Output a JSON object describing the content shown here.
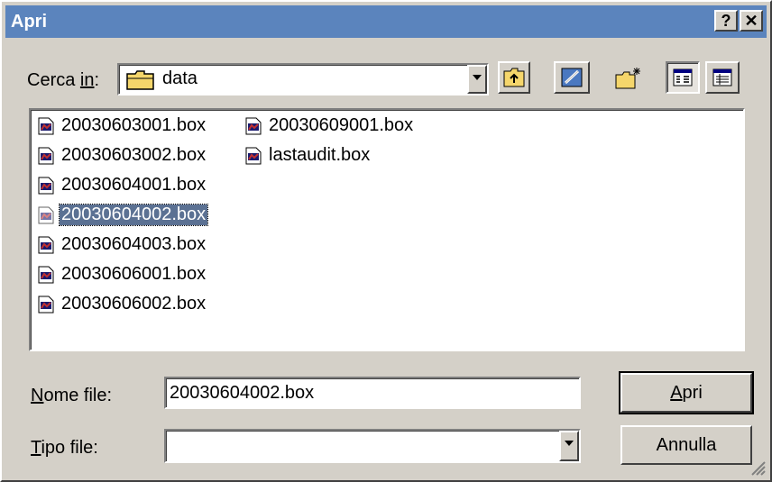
{
  "window": {
    "title": "Apri",
    "help_label": "?",
    "close_label": "✕"
  },
  "look_in": {
    "label_prefix": "Cerca ",
    "label_underline": "in",
    "label_suffix": ":",
    "value": "data",
    "folder_icon": "folder-icon"
  },
  "toolbar": {
    "up_icon": "up-folder-icon",
    "desktop_icon": "desktop-icon",
    "new_folder_icon": "new-folder-icon",
    "list_view_icon": "list-view-icon",
    "details_view_icon": "details-view-icon"
  },
  "files": [
    {
      "name": "20030603001.box",
      "selected": false
    },
    {
      "name": "20030603002.box",
      "selected": false
    },
    {
      "name": "20030604001.box",
      "selected": false
    },
    {
      "name": "20030604002.box",
      "selected": true
    },
    {
      "name": "20030604003.box",
      "selected": false
    },
    {
      "name": "20030606001.box",
      "selected": false
    },
    {
      "name": "20030606002.box",
      "selected": false
    },
    {
      "name": "20030609001.box",
      "selected": false
    },
    {
      "name": "lastaudit.box",
      "selected": false
    }
  ],
  "filename": {
    "label_underline": "N",
    "label_rest": "ome file:",
    "value": "20030604002.box"
  },
  "filetype": {
    "label_underline": "T",
    "label_rest": "ipo file:",
    "value": ""
  },
  "buttons": {
    "open_underline": "A",
    "open_rest": "pri",
    "cancel": "Annulla"
  },
  "colors": {
    "titlebar": "#5b84bd",
    "selection": "#5b7193",
    "face": "#d4d0c8"
  }
}
